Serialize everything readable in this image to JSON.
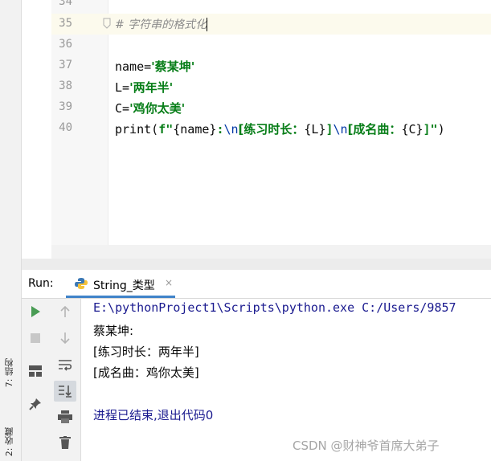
{
  "left_strip": {
    "structure_label": "7: 结构",
    "favorites_label": "2: 收藏"
  },
  "editor": {
    "line_numbers": [
      "34",
      "35",
      "36",
      "37",
      "38",
      "39",
      "40"
    ],
    "comment": "# 字符串的格式化",
    "line37": {
      "var": "name",
      "eq": "=",
      "str": "'蔡某坤'"
    },
    "line38": {
      "var": "L",
      "eq": "=",
      "str": "'两年半'"
    },
    "line39": {
      "var": "C",
      "eq": "=",
      "str": "'鸡你太美'"
    },
    "line40": {
      "func": "print(",
      "fprefix": "f\"",
      "p1": "{name}",
      "p2": ":",
      "esc1": "\\n",
      "p3": "[练习时长：",
      "p4": "{L}",
      "p5": "]",
      "esc2": "\\n",
      "p6": "[成名曲：",
      "p7": "{C}",
      "p8": "]\"",
      "close": ")"
    }
  },
  "run_panel": {
    "label": "Run:",
    "tab_title": "String_类型",
    "tab_close": "×",
    "console_lines": [
      "E:\\pythonProject1\\Scripts\\python.exe C:/Users/9857",
      "蔡某坤:",
      "[练习时长：两年半]",
      "[成名曲：鸡你太美]",
      "",
      "进程已结束,退出代码0"
    ]
  },
  "icons": [
    "run-icon",
    "stop-icon",
    "layout-icon",
    "pin-icon",
    "up-arrow-icon",
    "down-arrow-icon",
    "soft-wrap-icon",
    "scroll-to-end-icon",
    "print-icon",
    "trash-icon",
    "python-icon",
    "close-icon"
  ],
  "colors": {
    "accent": "#4083c9",
    "run_green": "#499c54",
    "string_green": "#067d17"
  },
  "watermark": "CSDN @财神爷首席大弟子"
}
